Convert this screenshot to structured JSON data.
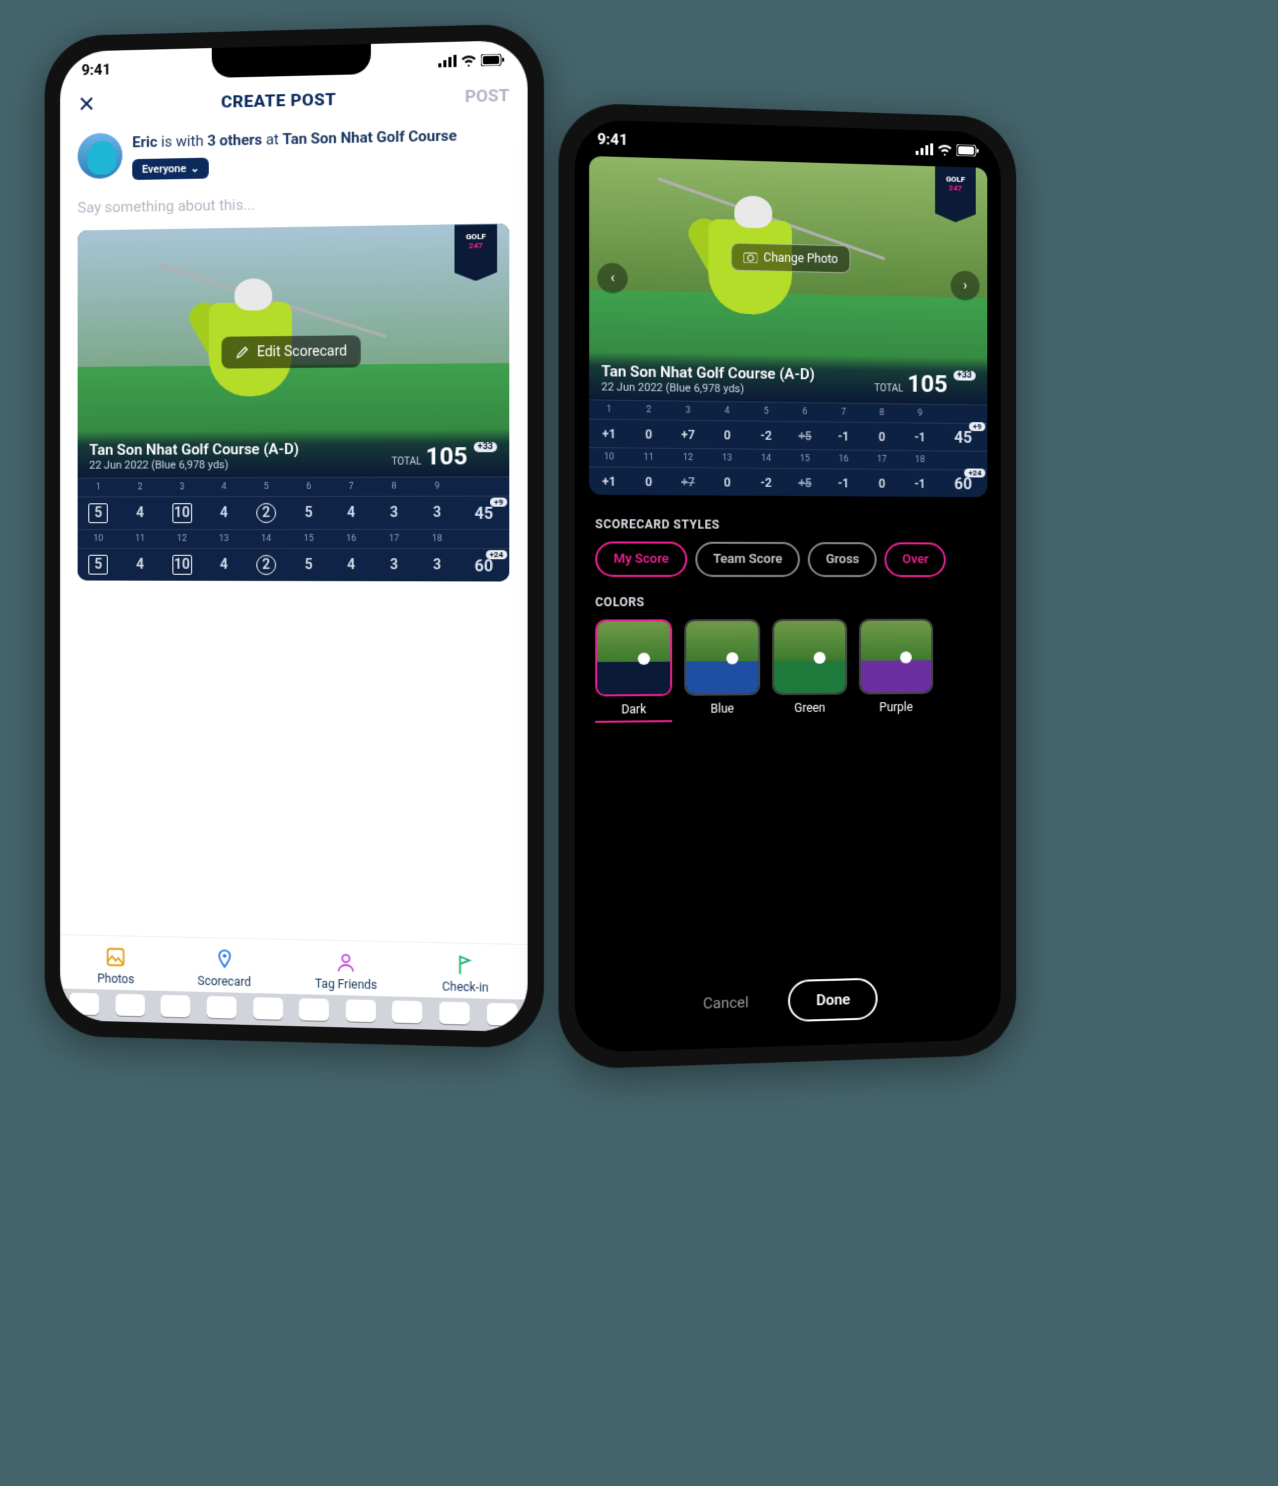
{
  "status_time": "9:41",
  "phone1": {
    "header_title": "CREATE POST",
    "post_button": "POST",
    "close_glyph": "✕",
    "author_name": "Eric",
    "with_word": "is with",
    "companions": "3 others",
    "at_word": "at",
    "location": "Tan Son Nhat Golf Course",
    "audience": "Everyone",
    "audience_chevron": "⌄",
    "placeholder": "Say something about this...",
    "badge_line1": "GOLF",
    "badge_line2": "247",
    "edit_label": "Edit Scorecard",
    "course_name": "Tan Son Nhat Golf Course (A-D)",
    "course_meta": "22 Jun 2022 (Blue 6,978 yds)",
    "total_label": "TOTAL",
    "total_value": "105",
    "total_badge": "+33",
    "holes_front": [
      "1",
      "2",
      "3",
      "4",
      "5",
      "6",
      "7",
      "8",
      "9"
    ],
    "scores_front": [
      {
        "v": "5",
        "s": "box"
      },
      {
        "v": "4",
        "s": ""
      },
      {
        "v": "10",
        "s": "box"
      },
      {
        "v": "4",
        "s": ""
      },
      {
        "v": "2",
        "s": "circ"
      },
      {
        "v": "5",
        "s": ""
      },
      {
        "v": "4",
        "s": ""
      },
      {
        "v": "3",
        "s": ""
      },
      {
        "v": "3",
        "s": ""
      }
    ],
    "front_sum": "45",
    "front_badge": "+9",
    "holes_back": [
      "10",
      "11",
      "12",
      "13",
      "14",
      "15",
      "16",
      "17",
      "18"
    ],
    "scores_back": [
      {
        "v": "5",
        "s": "box"
      },
      {
        "v": "4",
        "s": ""
      },
      {
        "v": "10",
        "s": "box"
      },
      {
        "v": "4",
        "s": ""
      },
      {
        "v": "2",
        "s": "circ"
      },
      {
        "v": "5",
        "s": ""
      },
      {
        "v": "4",
        "s": ""
      },
      {
        "v": "3",
        "s": ""
      },
      {
        "v": "3",
        "s": ""
      }
    ],
    "back_sum": "60",
    "back_badge": "+24",
    "nav": {
      "photos": "Photos",
      "scorecard": "Scorecard",
      "tag": "Tag Friends",
      "checkin": "Check-in"
    }
  },
  "phone2": {
    "badge_line1": "GOLF",
    "badge_line2": "247",
    "change_photo": "Change Photo",
    "course_name": "Tan Son Nhat Golf Course (A-D)",
    "course_meta": "22 Jun 2022 (Blue 6,978 yds)",
    "total_label": "TOTAL",
    "total_value": "105",
    "total_badge": "+33",
    "holes_front": [
      "1",
      "2",
      "3",
      "4",
      "5",
      "6",
      "7",
      "8",
      "9"
    ],
    "scores_front": [
      {
        "v": "+1"
      },
      {
        "v": "0"
      },
      {
        "v": "+7"
      },
      {
        "v": "0"
      },
      {
        "v": "-2"
      },
      {
        "v": "+5",
        "st": true
      },
      {
        "v": "-1"
      },
      {
        "v": "0"
      },
      {
        "v": "-1"
      }
    ],
    "front_sum": "45",
    "front_badge": "+9",
    "holes_back": [
      "10",
      "11",
      "12",
      "13",
      "14",
      "15",
      "16",
      "17",
      "18"
    ],
    "scores_back": [
      {
        "v": "+1"
      },
      {
        "v": "0"
      },
      {
        "v": "+7",
        "st": true
      },
      {
        "v": "0"
      },
      {
        "v": "-2"
      },
      {
        "v": "+5",
        "st": true
      },
      {
        "v": "-1"
      },
      {
        "v": "0"
      },
      {
        "v": "-1"
      }
    ],
    "back_sum": "60",
    "back_badge": "+24",
    "styles_label": "SCORECARD STYLES",
    "chips": [
      {
        "label": "My Score",
        "active": true
      },
      {
        "label": "Team Score",
        "active": false
      },
      {
        "label": "Gross",
        "active": false
      },
      {
        "label": "Over",
        "active": true
      }
    ],
    "colors_label": "COLORS",
    "colors": [
      {
        "name": "Dark",
        "hex": "#0b1a36",
        "selected": true
      },
      {
        "name": "Blue",
        "hex": "#1e4fa3",
        "selected": false
      },
      {
        "name": "Green",
        "hex": "#1d7a3a",
        "selected": false
      },
      {
        "name": "Purple",
        "hex": "#6b2fa0",
        "selected": false
      }
    ],
    "cancel": "Cancel",
    "done": "Done"
  }
}
